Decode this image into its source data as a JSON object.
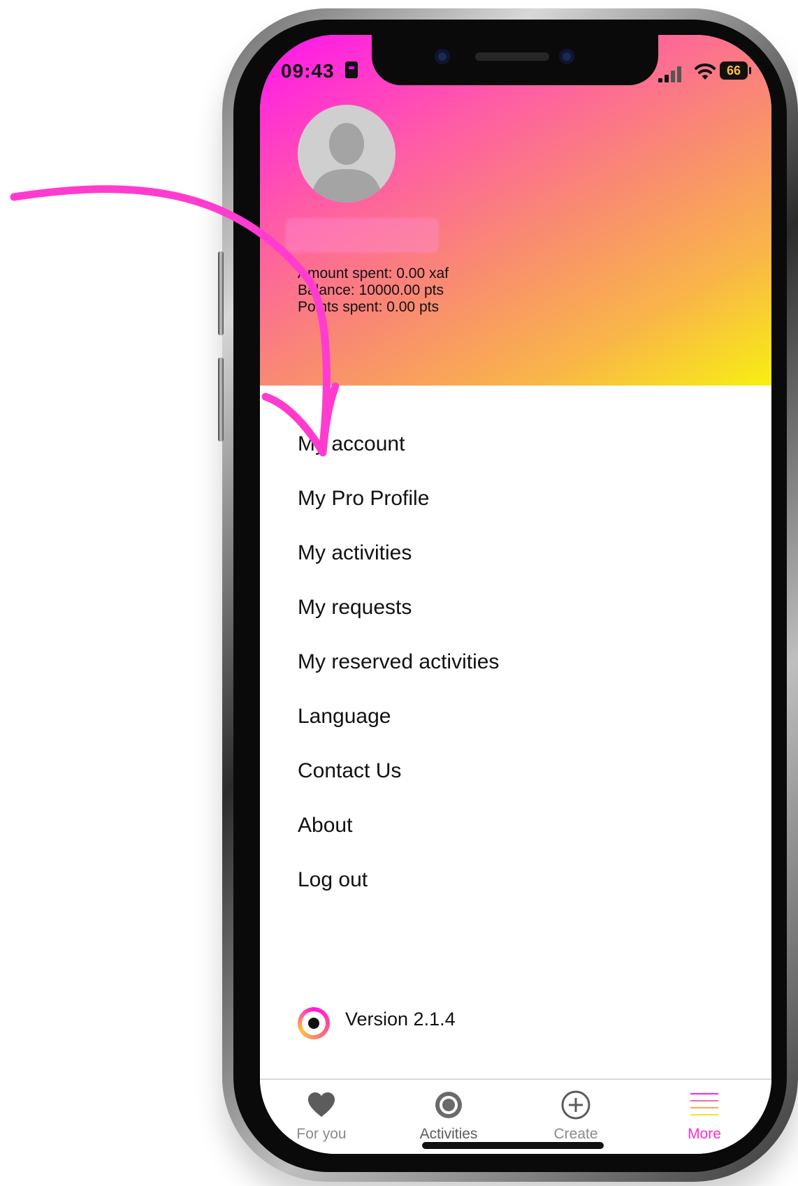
{
  "status_bar": {
    "time": "09:43",
    "battery": "66"
  },
  "profile": {
    "name": "",
    "stats": [
      "Amount spent: 0.00 xaf",
      "Balance: 10000.00 pts",
      "Points spent: 0.00 pts"
    ]
  },
  "menu": {
    "items": [
      "My account",
      "My Pro Profile",
      "My activities",
      "My requests",
      "My reserved activities",
      "Language",
      "Contact Us",
      "About",
      "Log out"
    ]
  },
  "version": "Version 2.1.4",
  "tabs": [
    {
      "label": "For you",
      "icon": "heart-icon"
    },
    {
      "label": "Activities",
      "icon": "target-icon"
    },
    {
      "label": "Create",
      "icon": "plus-circle-icon"
    },
    {
      "label": "More",
      "icon": "menu-lines-icon"
    }
  ],
  "colors": {
    "header_gradient": [
      "#ff14f0",
      "#f98a72",
      "#f8ef12"
    ],
    "arrow": "#ff3ccf",
    "active_tab": "#ff2bd0"
  }
}
